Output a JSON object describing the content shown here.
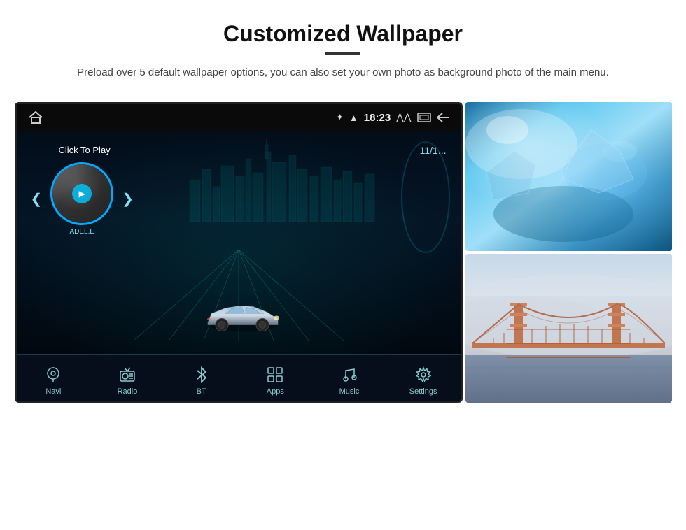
{
  "page": {
    "title": "Customized Wallpaper",
    "description": "Preload over 5 default wallpaper options, you can also set your own photo as background photo of the main menu."
  },
  "device": {
    "status_bar": {
      "time": "18:23",
      "icons": [
        "bluetooth",
        "wifi",
        "up-down-arrows",
        "window",
        "back"
      ]
    },
    "music": {
      "click_to_play": "Click To Play",
      "artist": "ADEL.E",
      "date": "11/1..."
    },
    "nav_items": [
      {
        "id": "navi",
        "label": "Navi",
        "icon": "📍"
      },
      {
        "id": "radio",
        "label": "Radio",
        "icon": "📻"
      },
      {
        "id": "bt",
        "label": "BT",
        "icon": "🔵"
      },
      {
        "id": "apps",
        "label": "Apps",
        "icon": "⚏"
      },
      {
        "id": "music",
        "label": "Music",
        "icon": "🎵"
      },
      {
        "id": "settings",
        "label": "Settings",
        "icon": "⚙"
      }
    ]
  },
  "side_images": [
    {
      "id": "blue-water",
      "alt": "Blue water/ice scene"
    },
    {
      "id": "golden-gate",
      "alt": "Golden Gate Bridge in fog"
    }
  ]
}
